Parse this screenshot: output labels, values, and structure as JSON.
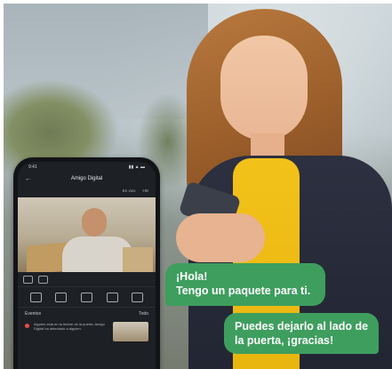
{
  "phone_app": {
    "screen_title": "Amigo Digital",
    "status_time": "9:41",
    "status_icons": "▮▮ ▲ ▬",
    "sub_header_left": "En vivo",
    "sub_header_right": "HD",
    "events_label": "Eventos",
    "events_link": "Todo",
    "event_text": "Alguien está en tu timbre de la puerta. Amigo Digital ha detectado a alguien."
  },
  "chat": {
    "courier_line1": "¡Hola!",
    "courier_line2": "Tengo un paquete para ti.",
    "reply_line1": "Puedes dejarlo al lado de",
    "reply_line2": "la puerta, ¡gracias!"
  },
  "colors": {
    "bubble": "#3e9e5e",
    "jacket": "#2c3040",
    "shirt": "#f2c21a",
    "phone_body": "#121418"
  },
  "icons": [
    "back-arrow-icon",
    "speaker-icon",
    "camera-icon",
    "microphone-icon",
    "record-icon",
    "screenshot-icon",
    "event-alert-icon"
  ]
}
